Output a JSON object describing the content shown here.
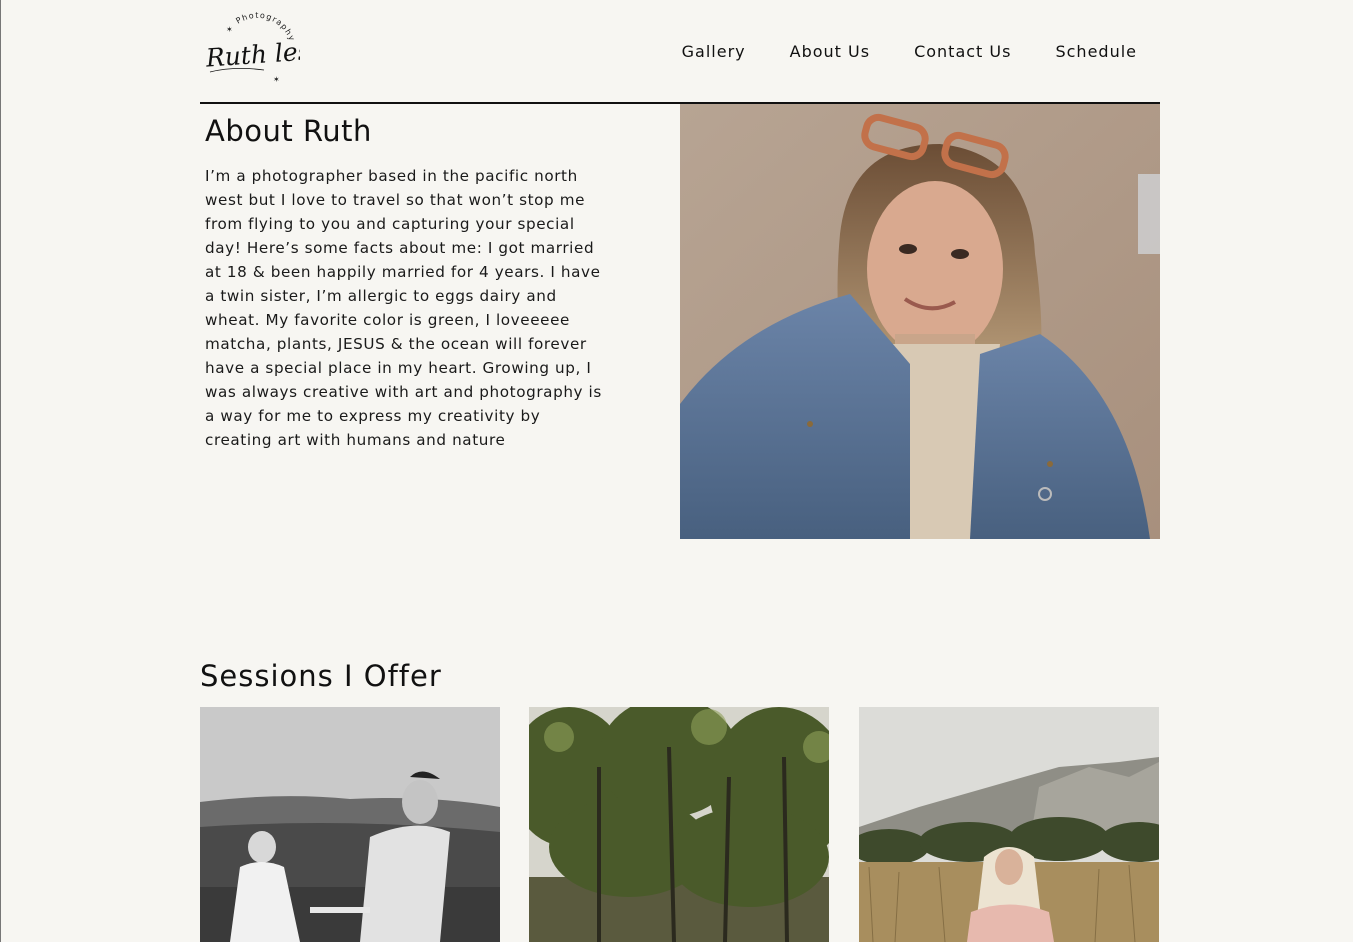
{
  "brand": {
    "script_name": "Ruth les",
    "tagline": "Photography"
  },
  "nav": {
    "items": [
      {
        "label": "Gallery"
      },
      {
        "label": "About Us"
      },
      {
        "label": "Contact Us"
      },
      {
        "label": "Schedule"
      }
    ]
  },
  "about": {
    "title": "About Ruth",
    "body": "I’m a photographer based in the pacific north west but I love to travel so that won’t stop me from flying to you and capturing your special day! Here’s some facts about me: I got married at 18 & been happily married for 4 years. I have a twin sister, I’m allergic to eggs dairy and wheat. My favorite color is green, I loveeeee matcha, plants, JESUS & the ocean will forever have a special place in my heart. Growing up, I was always creative with art and photography is a way for me to express my creativity by creating art with humans and nature"
  },
  "sessions": {
    "title": "Sessions I Offer"
  },
  "colors": {
    "background": "#f7f6f2",
    "text": "#111111",
    "rule": "#111111"
  }
}
